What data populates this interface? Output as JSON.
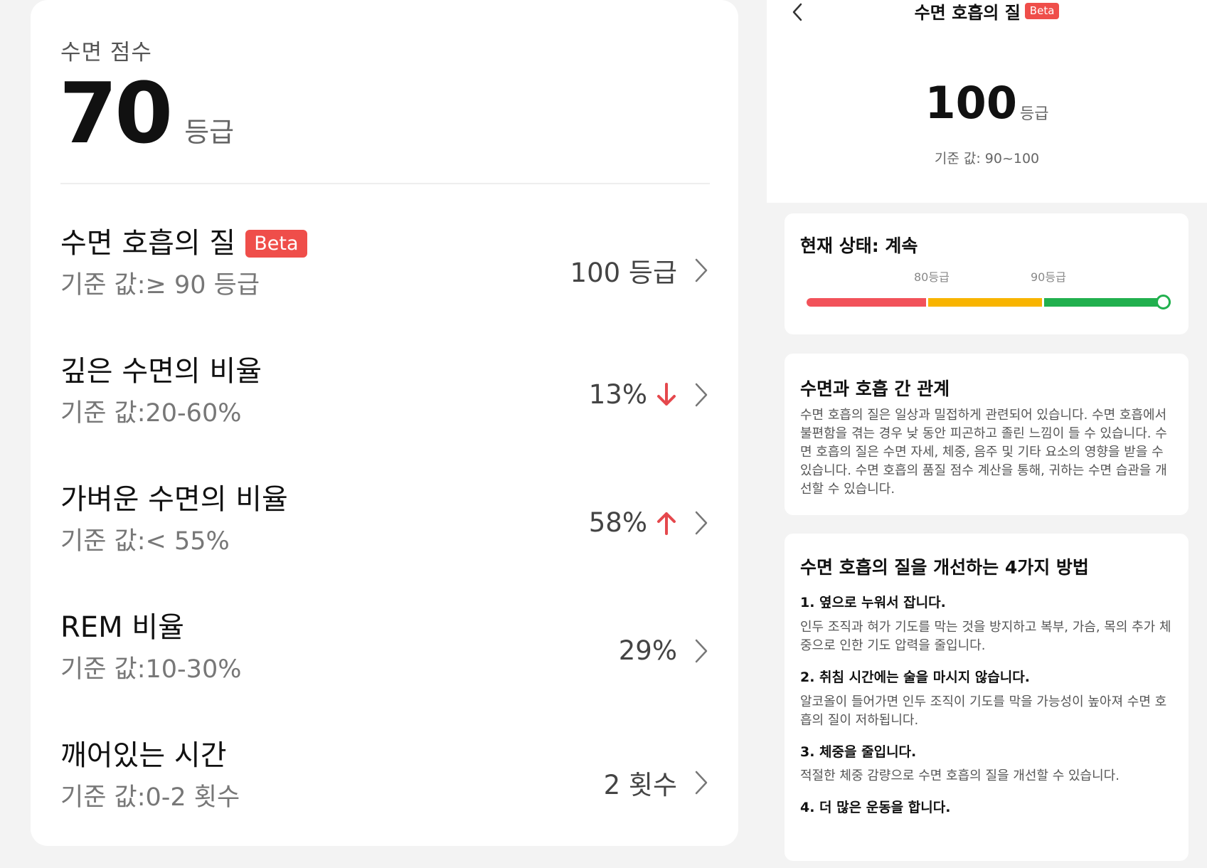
{
  "left": {
    "score_label": "수면 점수",
    "score_value": "70",
    "score_unit": "등급",
    "metrics": [
      {
        "title": "수면 호흡의 질",
        "badge": "Beta",
        "reference": "기준 값:≥ 90 등급",
        "value": "100 등급",
        "trend": ""
      },
      {
        "title": "깊은 수면의 비율",
        "reference": "기준 값:20-60%",
        "value": "13%",
        "trend": "down"
      },
      {
        "title": "가벼운 수면의 비율",
        "reference": "기준 값:< 55%",
        "value": "58%",
        "trend": "up"
      },
      {
        "title": "REM 비율",
        "reference": "기준 값:10-30%",
        "value": "29%",
        "trend": ""
      },
      {
        "title": "깨어있는 시간",
        "reference": "기준 값:0-2 횟수",
        "value": "2 횟수",
        "trend": ""
      }
    ],
    "colors": {
      "badge": "#ef4e4a",
      "trend_arrow": "#e5484d"
    }
  },
  "right": {
    "header": {
      "title": "수면 호흡의 질",
      "badge": "Beta",
      "back_icon": "back-arrow-icon"
    },
    "score": {
      "value": "100",
      "unit": "등급",
      "reference": "기준 값: 90~100"
    },
    "status": {
      "title": "현재 상태: 계속",
      "labels": [
        "80등급",
        "90등급"
      ],
      "current_level": 100,
      "colors": {
        "low": "#f2525a",
        "mid": "#f8b400",
        "high": "#21b04e"
      }
    },
    "relation": {
      "title": "수면과 호흡 간 관계",
      "body": "수면 호흡의 질은 일상과 밀접하게 관련되어 있습니다. 수면 호흡에서 불편함을 겪는 경우 낮 동안 피곤하고 졸린 느낌이 들 수 있습니다. 수면 호흡의 질은 수면 자세, 체중, 음주 및 기타 요소의 영향을 받을 수 있습니다. 수면 호흡의 품질 점수 계산을 통해, 귀하는 수면 습관을 개선할 수 있습니다."
    },
    "methods": {
      "title": "수면 호흡의 질을 개선하는 4가지 방법",
      "items": [
        {
          "heading": "1. 옆으로 누워서 잡니다.",
          "desc": "인두 조직과 혀가 기도를 막는 것을 방지하고 복부, 가슴, 목의 추가 체중으로 인한 기도 압력을 줄입니다."
        },
        {
          "heading": "2. 취침 시간에는 술을 마시지 않습니다.",
          "desc": "알코올이 들어가면 인두 조직이 기도를 막을 가능성이 높아져 수면 호흡의 질이 저하됩니다."
        },
        {
          "heading": "3. 체중을 줄입니다.",
          "desc": "적절한 체중 감량으로 수면 호흡의 질을 개선할 수 있습니다."
        },
        {
          "heading": "4. 더 많은 운동을 합니다.",
          "desc": ""
        }
      ]
    }
  }
}
